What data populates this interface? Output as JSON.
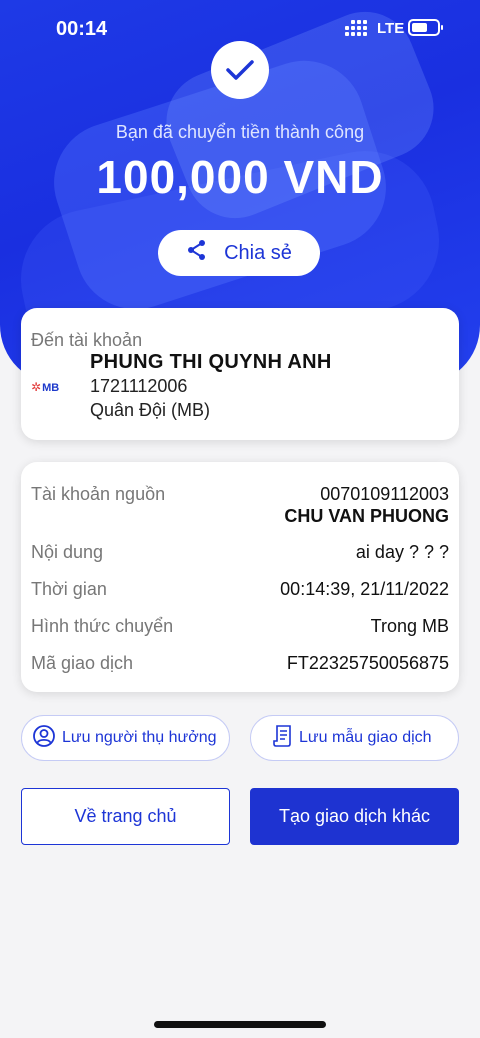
{
  "status_bar": {
    "time": "00:14",
    "network": "LTE"
  },
  "hero": {
    "subtitle": "Bạn đã chuyển tiền thành công",
    "amount": "100,000 VND",
    "share_label": "Chia sẻ"
  },
  "destination": {
    "label": "Đến tài khoản",
    "bank_logo": "MB",
    "name": "PHUNG THI QUYNH ANH",
    "account": "1721112006",
    "bank": "Quân Đội (MB)"
  },
  "details": {
    "source_label": "Tài khoản nguồn",
    "source_account": "0070109112003",
    "source_name": "CHU VAN PHUONG",
    "content_label": "Nội dung",
    "content_value": "ai day ? ? ?",
    "time_label": "Thời gian",
    "time_value": "00:14:39, 21/11/2022",
    "method_label": "Hình thức chuyển",
    "method_value": "Trong MB",
    "txn_label": "Mã giao dịch",
    "txn_value": "FT22325750056875"
  },
  "actions": {
    "save_recipient": "Lưu người thụ hưởng",
    "save_template": "Lưu mẫu giao dịch",
    "home": "Về trang chủ",
    "new_transaction": "Tạo giao dịch khác"
  },
  "colors": {
    "primary": "#1e33d1",
    "hero": "#1a2fe0"
  }
}
